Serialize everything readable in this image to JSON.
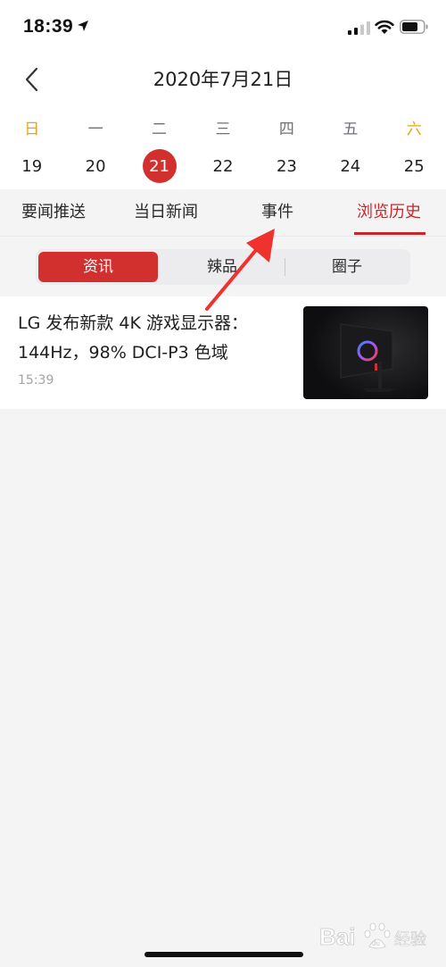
{
  "status_bar": {
    "time": "18:39"
  },
  "header": {
    "date_title": "2020年7月21日"
  },
  "calendar": {
    "weekdays": [
      "日",
      "一",
      "二",
      "三",
      "四",
      "五",
      "六"
    ],
    "days": [
      "19",
      "20",
      "21",
      "22",
      "23",
      "24",
      "25"
    ],
    "selected_day": "21",
    "colors": {
      "selected": "#d22f2f",
      "weekend": "#e8a317"
    }
  },
  "tabs": [
    {
      "label": "要闻推送"
    },
    {
      "label": "当日新闻"
    },
    {
      "label": "事件"
    },
    {
      "label": "浏览历史",
      "active": true
    }
  ],
  "segments": [
    {
      "label": "资讯",
      "active": true
    },
    {
      "label": "辣品"
    },
    {
      "label": "圈子"
    }
  ],
  "news": {
    "title": "LG 发布新款 4K 游戏显示器：144Hz，98% DCI-P3 色域",
    "time": "15:39"
  },
  "watermark": {
    "text": "Bai 经验",
    "logo_text": "du"
  },
  "accent_color": "#c9262c"
}
